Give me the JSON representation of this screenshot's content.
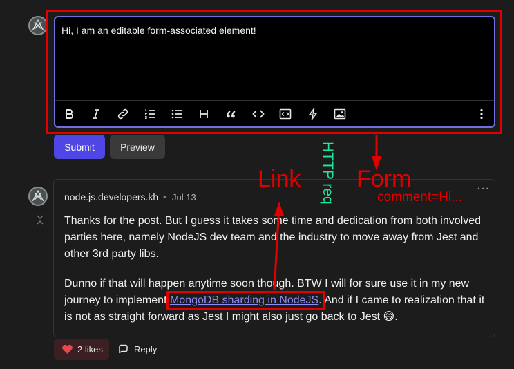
{
  "editor": {
    "text": "Hi, I am an editable form-associated element!",
    "toolbar_icons": [
      "bold-icon",
      "italic-icon",
      "link-icon",
      "ordered-list-icon",
      "unordered-list-icon",
      "heading-icon",
      "quote-icon",
      "code-icon",
      "code-block-icon",
      "lightning-icon",
      "image-icon",
      "more-vertical-icon"
    ]
  },
  "actions": {
    "submit_label": "Submit",
    "preview_label": "Preview"
  },
  "comment": {
    "author": "node.js.developers.kh",
    "separator": "•",
    "date": "Jul 13",
    "more_label": "···",
    "paragraph1": "Thanks for the post. But I guess it takes some time and dedication from both involved parties here, namely NodeJS dev team and the industry to move away from Jest and other 3rd party libs.",
    "paragraph2_before": "Dunno if that will happen anytime soon though. BTW I will for sure use it in my new journey to implement ",
    "paragraph2_link": "MongoDB sharding in NodeJS",
    "paragraph2_after": ". And if I came to realization that it is not as straight forward as Jest I might also just go back to Jest 😅.",
    "likes_label": "2 likes",
    "reply_label": "Reply"
  },
  "annotations": {
    "link": "Link",
    "form": "Form",
    "comment": "comment=Hi...",
    "http": "HTTP req"
  },
  "colors": {
    "annotation_red": "#e00000",
    "annotation_green": "#1fe89b",
    "accent": "#4f46e5",
    "link": "#8c8cf5",
    "editor_border": "#6f6fe0"
  }
}
